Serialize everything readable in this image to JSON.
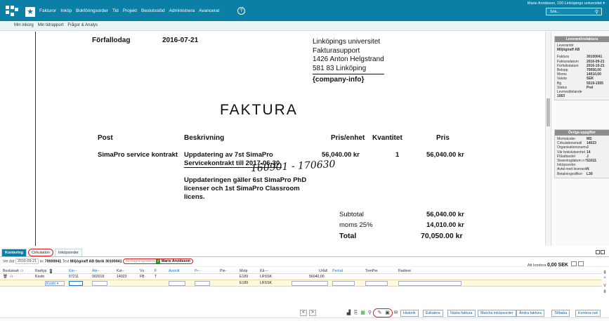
{
  "header": {
    "menu": [
      "Fakturor",
      "Inköp",
      "Bokföringsorder",
      "Tid",
      "Projekt",
      "Beslutsstöd",
      "Administrera",
      "Avancerat"
    ],
    "help": "?",
    "user": "Marie Arvidsson, 100 Linköpings universitet ▾",
    "search_placeholder": "Sök...",
    "subnav": [
      "Min inkorg",
      "Min tidrapport",
      "Frågor & Analys"
    ]
  },
  "invoice": {
    "due_label": "Förfallodag",
    "due_date": "2016-07-21",
    "recipient": [
      "Linköpings universitet",
      "Fakturasupport",
      "1426 Anton Helgstrand",
      "581 83 Linköping",
      "{company-info}"
    ],
    "title": "FAKTURA",
    "col_post": "Post",
    "col_desc": "Beskrivning",
    "col_unit": "Pris/enhet",
    "col_qty": "Kvantitet",
    "col_price": "Pris",
    "item_post": "SimaPro service kontrakt",
    "item_desc1": "Uppdatering av 7st SimaPro",
    "item_desc2": "Servicekontrakt till 2017-06-30.",
    "item_unit": "56,040.00 kr",
    "item_qty": "1",
    "item_price": "56,040.00 kr",
    "handwriting": "160901 - 170630",
    "note1": "Uppdateringen gäller 6st SimaPro PhD",
    "note2": "licenser och 1st SimaPro Classroom",
    "note3": "licens.",
    "subtotal_label": "Subtotal",
    "subtotal_value": "56,040.00 kr",
    "vat_label": "moms 25%",
    "vat_value": "14,010.00 kr",
    "total_label": "Total",
    "total_value": "70,050.00 kr"
  },
  "supplier_box": {
    "title": "Leverantörsfaktura",
    "leverantor_label": "Leverantör",
    "leverantor": "Miljögiraff AB",
    "rows": [
      {
        "k": "Faktura",
        "v": "30100041"
      },
      {
        "k": "Fakturadatum",
        "v": "2016-09-21"
      },
      {
        "k": "Förfallodatum",
        "v": "2016-10-21"
      },
      {
        "k": "Belopp",
        "v": "70050,00"
      },
      {
        "k": "Moms",
        "v": "14010,00"
      },
      {
        "k": "Valuta",
        "v": "SEK"
      },
      {
        "k": "Bg",
        "v": "5519-1555"
      },
      {
        "k": "Status",
        "v": "Prel"
      }
    ],
    "levmed_label": "Levmeddelande",
    "levmed": "1063"
  },
  "other_box": {
    "title": "Övriga uppgifter",
    "rows": [
      {
        "k": "Momskoder",
        "v": "MS"
      },
      {
        "k": "Cirkulationsmall",
        "v": "14023"
      },
      {
        "k": "Organisationsnummer",
        "v": "J"
      },
      {
        "k": "Vår bokslutsenhet",
        "v": "14"
      },
      {
        "k": "F5kattsedel",
        "v": "J"
      },
      {
        "k": "Skanningdatum o Nr",
        "v": "S1611"
      },
      {
        "k": "Inköpsorder",
        "v": ""
      },
      {
        "k": "Avtal med leverantör",
        "v": "N"
      },
      {
        "k": "Betalningsvillkor",
        "v": "L30"
      }
    ]
  },
  "tabs": [
    "Kontering",
    "Cirkulation",
    "Inköpsorder"
  ],
  "info": {
    "ver_dat_label": "Ver.dat",
    "ver_dat": "2016-09-21",
    "lnr_label": "lvr",
    "lnr": "70000041",
    "text_label": "Text",
    "text": "Miljögiraff AB Skrik 30100041",
    "mottag_label": "Mottagningsattest",
    "mottag_check": "✓",
    "mottag_user": "Marie Arvidsson",
    "att_label": "Att kontera",
    "att_value": "0,00 SEK"
  },
  "table": {
    "headers": [
      "Beslutsatt",
      "Radtyp",
      "Kto--",
      "Akt--",
      "Kst--",
      "Vs",
      "F",
      "Avsnitt",
      "Pr--",
      "Pin-",
      "Motp",
      "Kå---",
      "Urfall",
      "Period",
      "TomPer",
      "Radtext"
    ],
    "row1": [
      "Kostn",
      "57211",
      "902018",
      "14023",
      "FB",
      "T",
      "",
      "",
      "",
      "E189",
      "LRSSK",
      "56040,00",
      "",
      "",
      ""
    ],
    "row2_type": "Kostn",
    "row2_motp": "E189",
    "row2_ka": "LRSSK"
  },
  "buttons": [
    "Historik",
    "Eskalera",
    "Nästa faktura",
    "Matcha inköpsorder",
    "Ändra faktura",
    "Tillbaka",
    "Kontera rad"
  ],
  "nav": {
    "prev": "<",
    "next": ">"
  }
}
